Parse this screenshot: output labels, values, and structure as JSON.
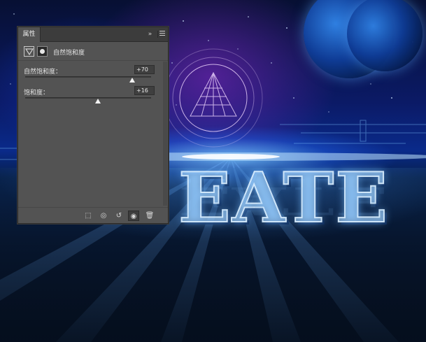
{
  "panel": {
    "tab_label": "属性",
    "collapse_glyph": "»",
    "menu_icon": "hamburger-menu-icon",
    "title": "自然饱和度",
    "title_icons": [
      "vibrance-adjustment-icon",
      "layer-mask-icon"
    ],
    "properties": [
      {
        "label": "自然饱和度：",
        "value": "+70",
        "slider_min": -100,
        "slider_max": 100,
        "slider_value": 70
      },
      {
        "label": "饱和度：",
        "value": "+16",
        "slider_min": -100,
        "slider_max": 100,
        "slider_value": 16
      }
    ],
    "footer_icons": [
      {
        "name": "clip-to-layer-icon",
        "glyph": "⬚"
      },
      {
        "name": "view-previous-state-icon",
        "glyph": "◎"
      },
      {
        "name": "reset-icon",
        "glyph": "↺"
      },
      {
        "name": "visibility-icon",
        "glyph": "◉"
      },
      {
        "name": "delete-icon",
        "glyph": "🗑"
      }
    ]
  },
  "canvas": {
    "artwork_text": "EATE"
  },
  "colors": {
    "panel_bg": "#535353",
    "panel_header_bg": "#3c3c3c",
    "field_bg": "#3f3f3f",
    "text": "#e2e2e2",
    "canvas_glow": "#78c8ff"
  }
}
